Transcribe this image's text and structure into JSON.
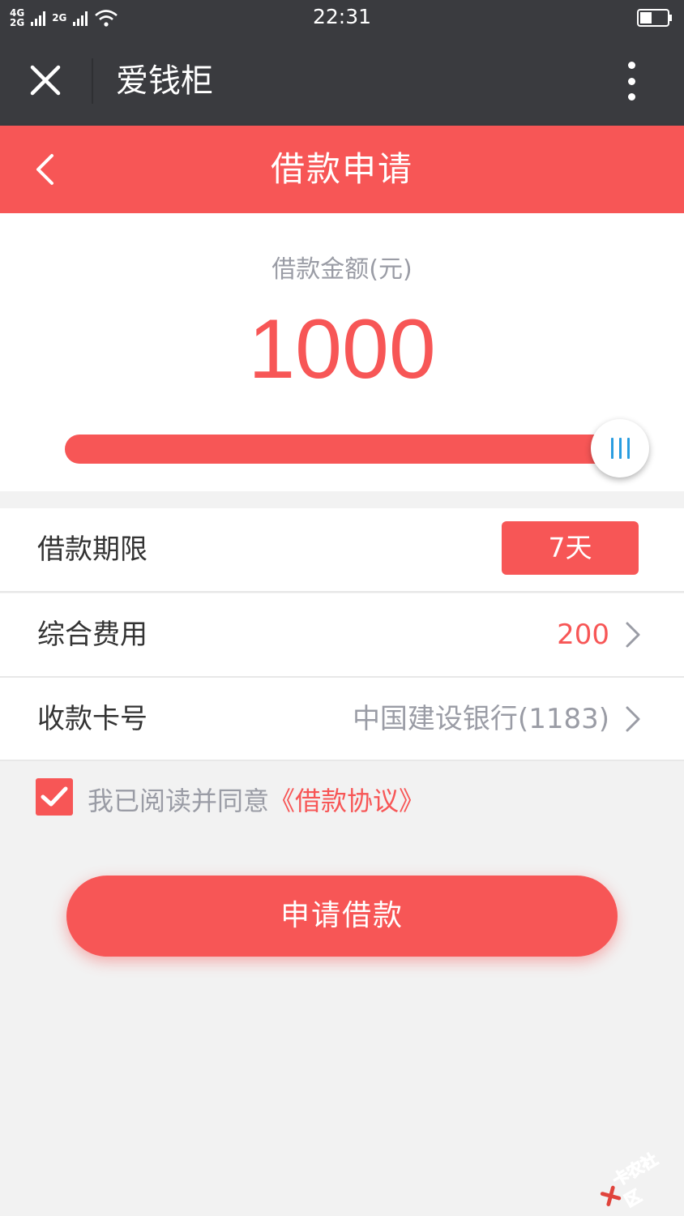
{
  "status_bar": {
    "network_top": "4G",
    "network_bottom": "2G",
    "network_second": "2G",
    "time": "22:31"
  },
  "title_bar": {
    "title": "爱钱柜",
    "close_icon": "close-icon",
    "more_icon": "more-vertical-icon"
  },
  "header": {
    "title": "借款申请",
    "back_icon": "chevron-left-icon"
  },
  "amount": {
    "label": "借款金额(元)",
    "value": "1000",
    "slider_fraction": 1.0
  },
  "rows": {
    "term": {
      "label": "借款期限",
      "value": "7天"
    },
    "fee": {
      "label": "综合费用",
      "value": "200"
    },
    "card": {
      "label": "收款卡号",
      "value": "中国建设银行(1183)"
    }
  },
  "agreement": {
    "checked": true,
    "text": "我已阅读并同意",
    "link": "《借款协议》"
  },
  "submit": {
    "label": "申请借款"
  },
  "watermark": {
    "text": "卡农社区"
  },
  "colors": {
    "accent": "#f75656",
    "dark_bar": "#3a3b3f",
    "gray_text": "#9a9ca5",
    "slider_thumb_lines": "#2a9de0"
  }
}
